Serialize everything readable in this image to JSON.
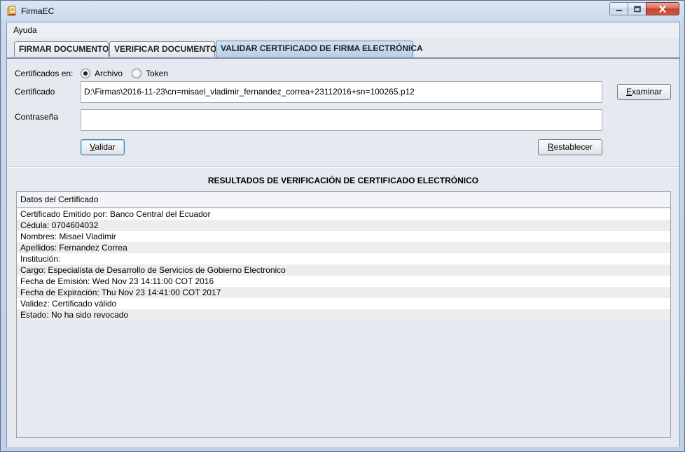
{
  "window": {
    "title": "FirmaEC",
    "controls": [
      "minimize-icon",
      "maximize-icon",
      "close-icon"
    ]
  },
  "menu": {
    "items": [
      "Ayuda"
    ]
  },
  "tabs": [
    {
      "label": "FIRMAR DOCUMENTO",
      "active": false
    },
    {
      "label": "VERIFICAR DOCUMENTO",
      "active": false
    },
    {
      "label": "VALIDAR CERTIFICADO DE FIRMA ELECTRÓNICA",
      "active": true
    }
  ],
  "form": {
    "source_label": "Certificados en:",
    "options": [
      {
        "label": "Archivo",
        "selected": true
      },
      {
        "label": "Token",
        "selected": false
      }
    ],
    "certificate_label": "Certificado",
    "certificate_value": "D:\\Firmas\\2016-11-23\\cn=misael_vladimir_fernandez_correa+23112016+sn=100265.p12",
    "password_label": "Contraseña",
    "password_value": "",
    "browse_button": {
      "mnemonic": "E",
      "rest": "xaminar"
    },
    "validate_button": {
      "mnemonic": "V",
      "rest": "alidar"
    },
    "reset_button": {
      "mnemonic": "R",
      "rest": "establecer"
    }
  },
  "results": {
    "title": "RESULTADOS DE VERIFICACIÓN DE CERTIFICADO ELECTRÓNICO",
    "column_header": "Datos del Certificado",
    "rows": [
      "Certificado Emitido por: Banco Central del Ecuador",
      "Cédula: 0704604032",
      "Nombres: Misael Vladimir",
      "Apellidos: Fernandez Correa",
      "Institución:",
      "Cargo: Especialista de Desarrollo de Servicios de Gobierno Electronico",
      "Fecha de Emisión: Wed Nov 23 14:11:00 COT 2016",
      "Fecha de Expiración: Thu Nov 23 14:41:00 COT 2017",
      "Validez: Certificado válido",
      "Estado: No ha sido revocado"
    ]
  },
  "colors": {
    "active_tab": "#b9cfe8",
    "panel_bg": "#e6e9ef",
    "close_button": "#c4432e"
  }
}
